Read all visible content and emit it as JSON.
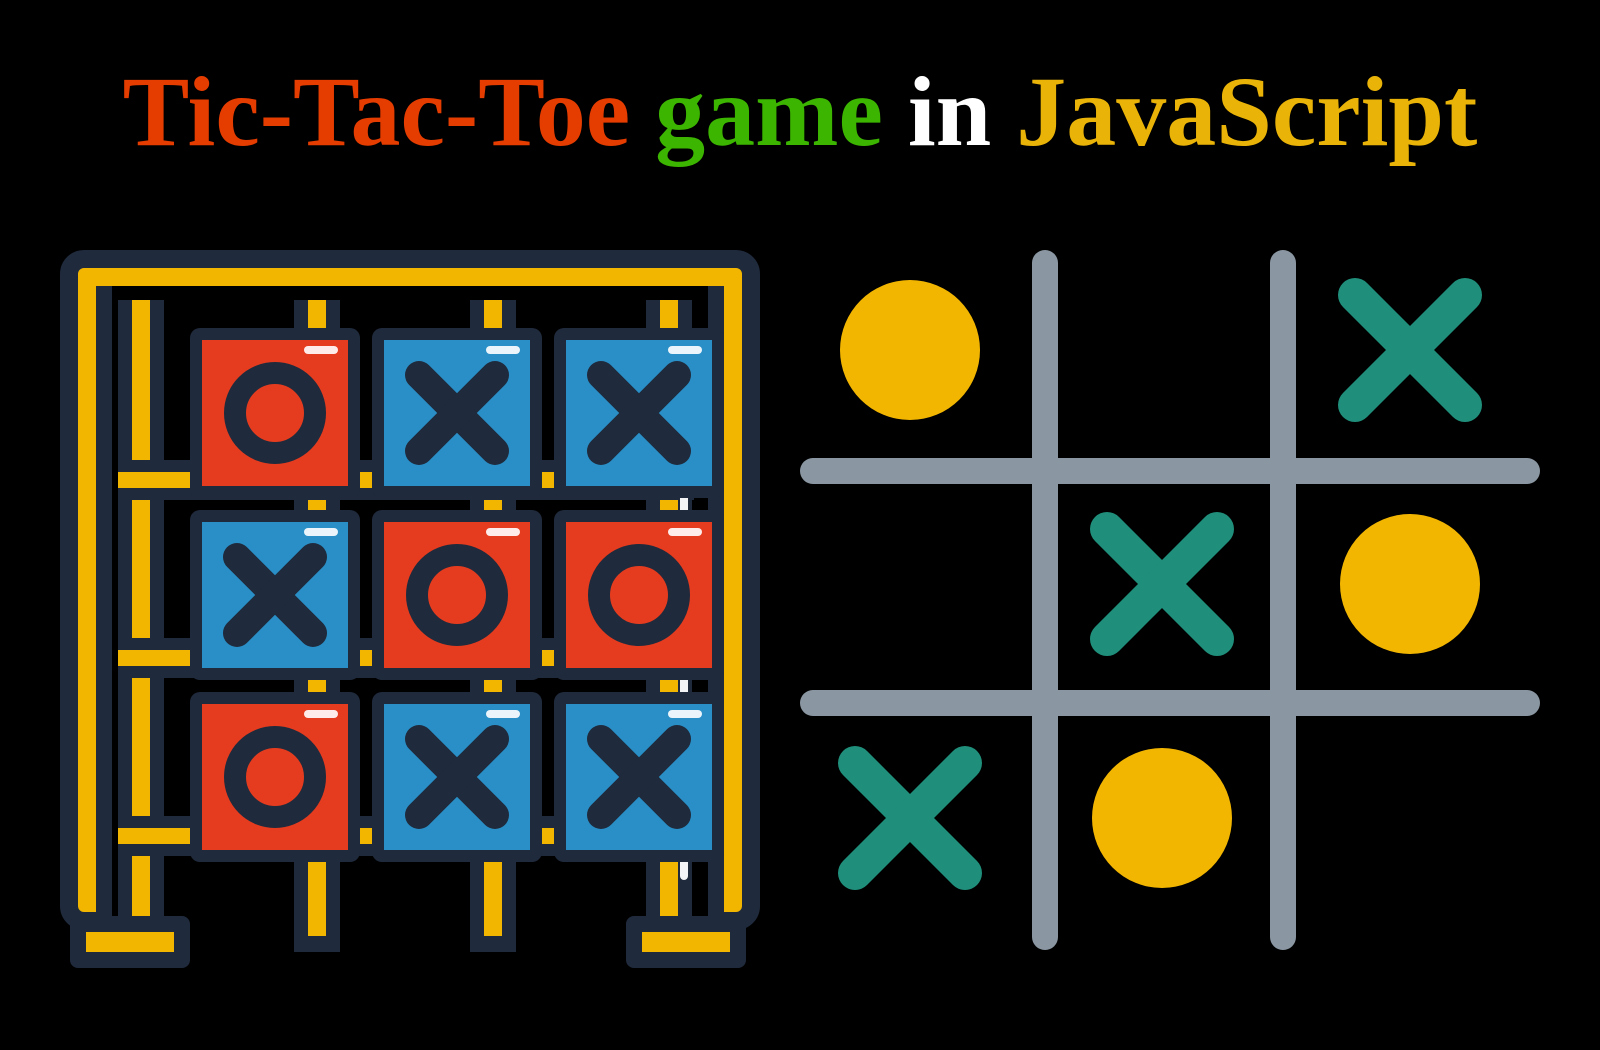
{
  "title": {
    "w1": "Tic-Tac-Toe",
    "w2": "game",
    "w3": "in",
    "w4": "JavaScript"
  },
  "colors": {
    "red": "#e53c00",
    "green": "#3cb500",
    "gold": "#eab308",
    "frame_gold": "#f3b600",
    "dark_navy": "#1f2a3c",
    "tile_red": "#e53c1f",
    "tile_blue": "#2a8fc7",
    "grid_grey": "#8a97a3",
    "teal": "#1f8f7b"
  },
  "left_board": {
    "cells": [
      {
        "pos": "0,0",
        "mark": "O",
        "tile": "red"
      },
      {
        "pos": "0,1",
        "mark": "X",
        "tile": "blue"
      },
      {
        "pos": "0,2",
        "mark": "X",
        "tile": "blue"
      },
      {
        "pos": "1,0",
        "mark": "X",
        "tile": "blue"
      },
      {
        "pos": "1,1",
        "mark": "O",
        "tile": "red"
      },
      {
        "pos": "1,2",
        "mark": "O",
        "tile": "red"
      },
      {
        "pos": "2,0",
        "mark": "O",
        "tile": "red"
      },
      {
        "pos": "2,1",
        "mark": "X",
        "tile": "blue"
      },
      {
        "pos": "2,2",
        "mark": "X",
        "tile": "blue"
      }
    ]
  },
  "right_board": {
    "cells": [
      {
        "pos": "0,0",
        "mark": "O"
      },
      {
        "pos": "0,1",
        "mark": ""
      },
      {
        "pos": "0,2",
        "mark": "X"
      },
      {
        "pos": "1,0",
        "mark": ""
      },
      {
        "pos": "1,1",
        "mark": "X"
      },
      {
        "pos": "1,2",
        "mark": "O"
      },
      {
        "pos": "2,0",
        "mark": "X"
      },
      {
        "pos": "2,1",
        "mark": "O"
      },
      {
        "pos": "2,2",
        "mark": ""
      }
    ]
  }
}
